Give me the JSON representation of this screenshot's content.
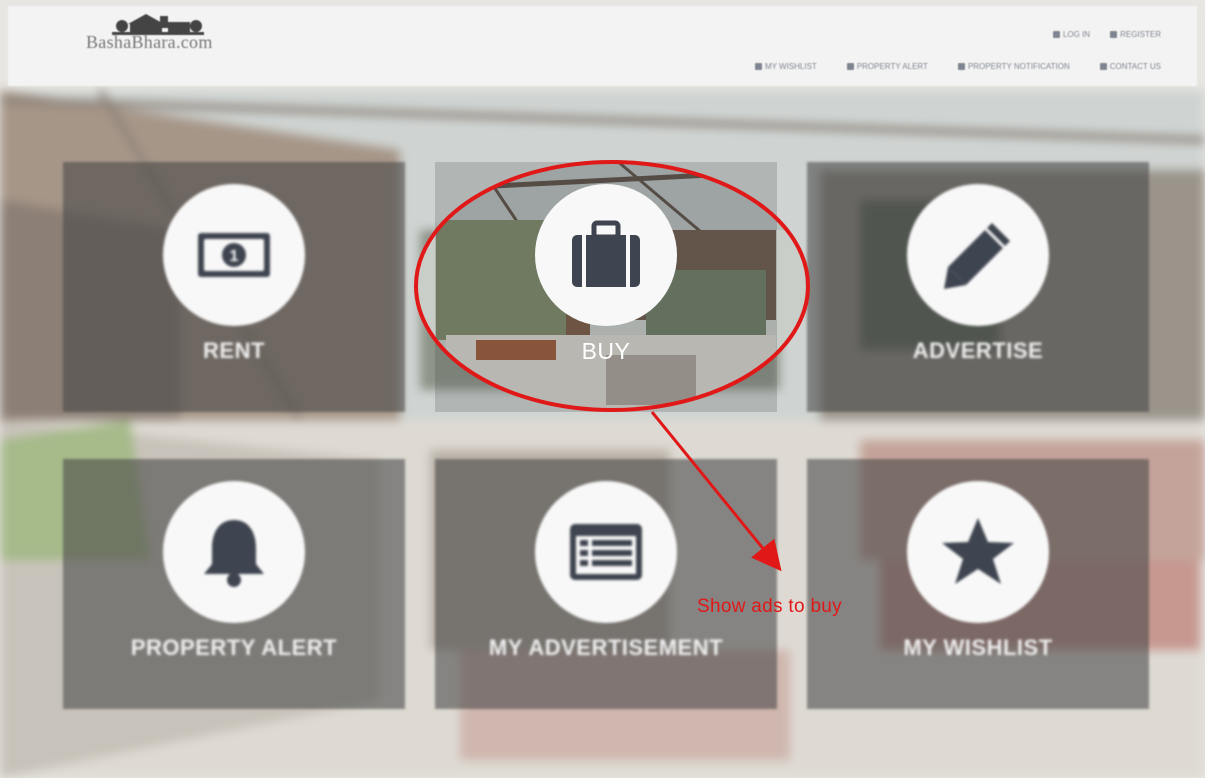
{
  "site": {
    "logo_text": "BashaBhara.com"
  },
  "top_nav": [
    {
      "label": "LOG IN",
      "icon": "login-icon"
    },
    {
      "label": "REGISTER",
      "icon": "user-icon"
    }
  ],
  "main_nav": [
    {
      "label": "MY WISHLIST",
      "icon": "wishlist-icon"
    },
    {
      "label": "PROPERTY ALERT",
      "icon": "alert-icon"
    },
    {
      "label": "PROPERTY NOTIFICATION",
      "icon": "notification-icon"
    },
    {
      "label": "CONTACT US",
      "icon": "phone-icon"
    }
  ],
  "tiles": [
    {
      "label": "RENT",
      "icon": "money-icon"
    },
    {
      "label": "BUY",
      "icon": "briefcase-icon"
    },
    {
      "label": "ADVERTISE",
      "icon": "pencil-icon"
    },
    {
      "label": "PROPERTY ALERT",
      "icon": "bell-icon"
    },
    {
      "label": "MY ADVERTISEMENT",
      "icon": "list-icon"
    },
    {
      "label": "MY WISHLIST",
      "icon": "star-icon"
    }
  ],
  "annotation": {
    "text": "Show ads to buy",
    "color": "#e01818"
  },
  "colors": {
    "icon": "#3f4550",
    "tile_overlay": "#464646",
    "annotation_red": "#e01818"
  }
}
